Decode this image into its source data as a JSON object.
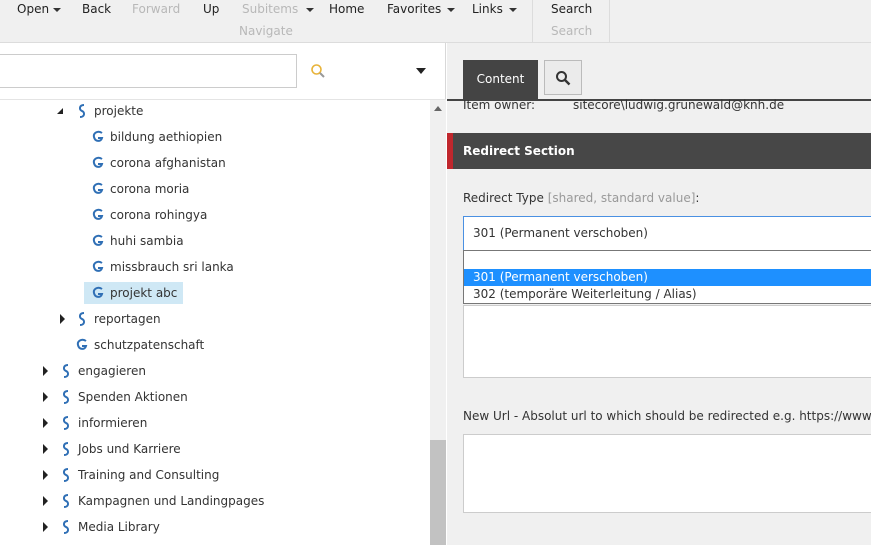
{
  "ribbon": {
    "open": "Open",
    "back": "Back",
    "forward": "Forward",
    "up": "Up",
    "subitems": "Subitems",
    "home": "Home",
    "favorites": "Favorites",
    "links": "Links",
    "navigate_group": "Navigate",
    "search": "Search",
    "search_group": "Search"
  },
  "tree": {
    "items": [
      {
        "label": "projekte"
      },
      {
        "label": "bildung aethiopien"
      },
      {
        "label": "corona afghanistan"
      },
      {
        "label": "corona moria"
      },
      {
        "label": "corona rohingya"
      },
      {
        "label": "huhi sambia"
      },
      {
        "label": "missbrauch sri lanka"
      },
      {
        "label": "projekt abc"
      },
      {
        "label": "reportagen"
      },
      {
        "label": "schutzpatenschaft"
      },
      {
        "label": "engagieren"
      },
      {
        "label": "Spenden Aktionen"
      },
      {
        "label": "informieren"
      },
      {
        "label": "Jobs und Karriere"
      },
      {
        "label": "Training and Consulting"
      },
      {
        "label": "Kampagnen und Landingpages"
      },
      {
        "label": "Media Library"
      }
    ]
  },
  "editor": {
    "tab_content": "Content",
    "item_owner_label": "Item owner:",
    "item_owner_value": "sitecore\\ludwig.grunewald@knh.de",
    "section_title": "Redirect Section",
    "redirect_type_label": "Redirect Type",
    "redirect_type_hint": "[shared, standard value]",
    "redirect_type_colon": ":",
    "redirect_type_value": "301 (Permanent verschoben)",
    "options": [
      "301 (Permanent verschoben)",
      "302 (temporäre Weiterleitung / Alias)"
    ],
    "new_url_label": "New Url - Absolut url to which should be redirected e.g. https://www.kind"
  },
  "colors": {
    "section_accent": "#c0272d",
    "tree_icon": "#2f6fb5",
    "selection": "#1e90ff",
    "tree_selected": "#cfe8f5"
  }
}
